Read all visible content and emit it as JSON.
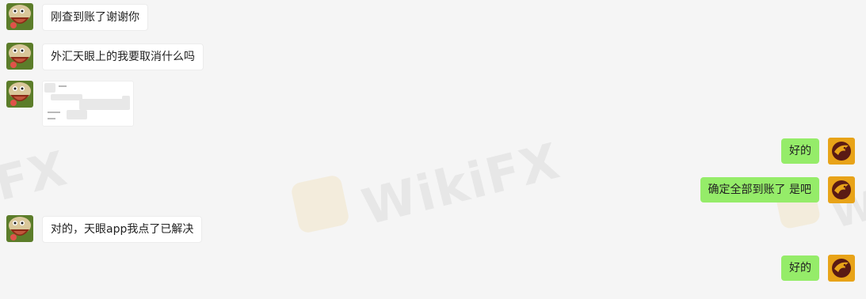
{
  "watermark": {
    "brand": "WikiFX",
    "fragment_left": "FX",
    "fragment_right": "W"
  },
  "colors": {
    "background": "#f5f5f5",
    "incoming_bubble": "#ffffff",
    "outgoing_bubble": "#95ec69",
    "outgoing_avatar": "#e8a318",
    "incoming_avatar": "#6b8f2a"
  },
  "messages": [
    {
      "side": "incoming",
      "text": "刚查到账了谢谢你",
      "avatar": "cartoon-dinosaur-avatar"
    },
    {
      "side": "incoming",
      "text": "外汇天眼上的我要取消什么吗",
      "avatar": "cartoon-dinosaur-avatar"
    },
    {
      "side": "incoming",
      "image": "blurred-screenshot-thumbnail",
      "avatar": "cartoon-dinosaur-avatar"
    },
    {
      "side": "outgoing",
      "text": "好的",
      "avatar": "eagle-logo-avatar"
    },
    {
      "side": "outgoing",
      "text": "确定全部到账了  是吧",
      "avatar": "eagle-logo-avatar"
    },
    {
      "side": "incoming",
      "text": "对的，天眼app我点了已解决",
      "avatar": "cartoon-dinosaur-avatar"
    },
    {
      "side": "outgoing",
      "text": "好的",
      "avatar": "eagle-logo-avatar"
    }
  ]
}
